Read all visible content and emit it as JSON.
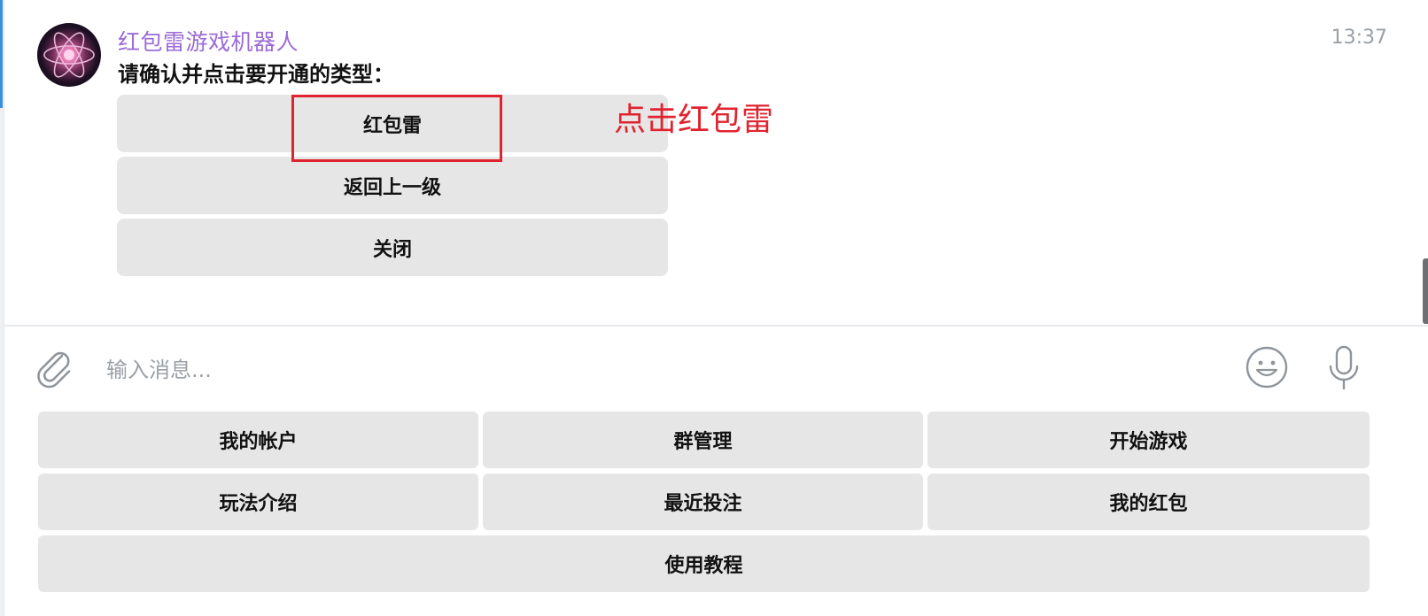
{
  "message": {
    "sender": "红包雷游戏机器人",
    "time": "13:37",
    "text": "请确认并点击要开通的类型：",
    "inline_buttons": [
      "红包雷",
      "返回上一级",
      "关闭"
    ]
  },
  "annotation": {
    "text": "点击红包雷",
    "color": "#e0242f"
  },
  "composer": {
    "placeholder": "输入消息..."
  },
  "keyboard": {
    "rows": [
      [
        "我的帐户",
        "群管理",
        "开始游戏"
      ],
      [
        "玩法介绍",
        "最近投注",
        "我的红包"
      ],
      [
        "使用教程"
      ]
    ]
  },
  "colors": {
    "sender_name": "#9b6bd6",
    "button_bg": "#e6e6e6",
    "accent": "#3a8fe0"
  },
  "icons": [
    "attach-icon",
    "emoji-icon",
    "microphone-icon",
    "bot-avatar"
  ]
}
